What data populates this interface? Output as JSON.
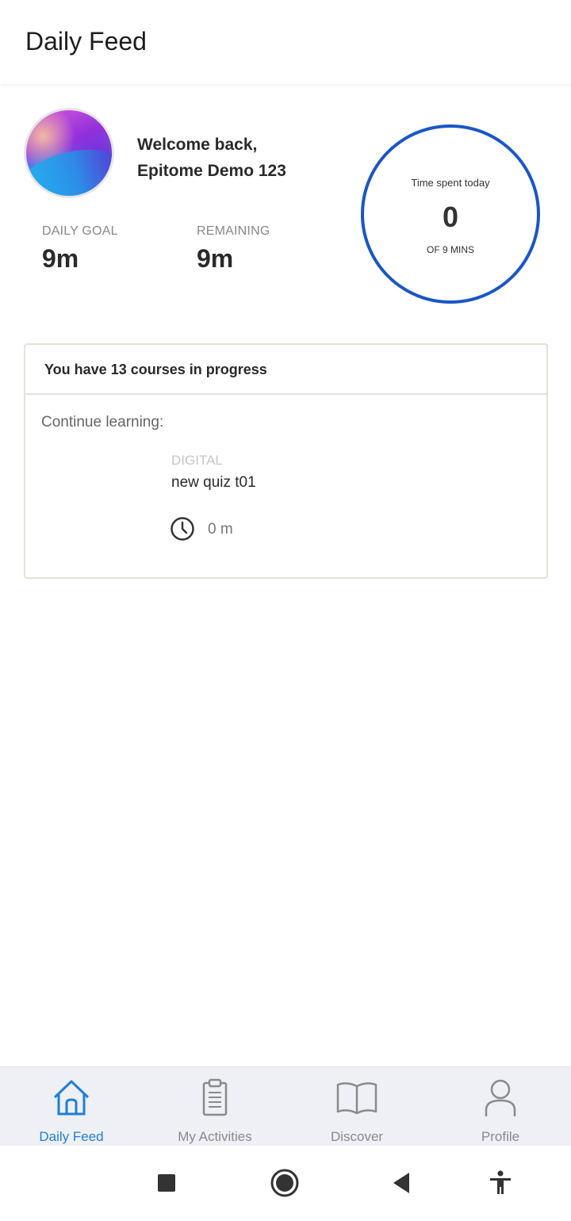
{
  "header": {
    "title": "Daily Feed"
  },
  "profile": {
    "welcome_line1": "Welcome back,",
    "welcome_line2": "Epitome Demo 123"
  },
  "stats": {
    "daily_goal": {
      "label": "DAILY GOAL",
      "value": "9m"
    },
    "remaining": {
      "label": "REMAINING",
      "value": "9m"
    }
  },
  "time_ring": {
    "title": "Time spent today",
    "value": "0",
    "subtitle": "OF 9 MINS",
    "accent": "#1a56c9"
  },
  "courses": {
    "header": "You have 13 courses in progress",
    "continue_label": "Continue learning:",
    "item": {
      "category": "DIGITAL",
      "title": "new quiz t01",
      "duration": "0 m"
    }
  },
  "bottom_nav": {
    "items": [
      {
        "label": "Daily Feed",
        "icon": "home-icon",
        "active": true
      },
      {
        "label": "My Activities",
        "icon": "clipboard-icon",
        "active": false
      },
      {
        "label": "Discover",
        "icon": "book-icon",
        "active": false
      },
      {
        "label": "Profile",
        "icon": "person-icon",
        "active": false
      }
    ],
    "active_color": "#1f7fd6"
  },
  "system_nav": {
    "buttons": [
      "recent-apps",
      "home",
      "back",
      "accessibility"
    ]
  }
}
